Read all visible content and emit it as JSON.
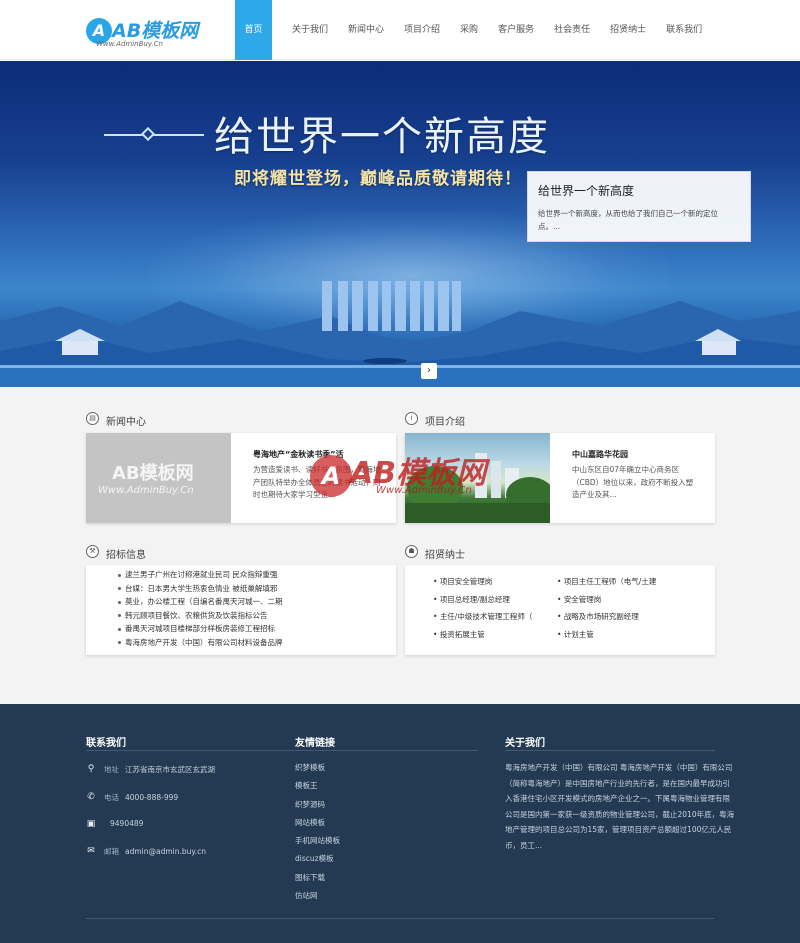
{
  "header": {
    "logo_mark": "A",
    "logo_name": "AB模板网",
    "logo_url": "Www.AdminBuy.Cn",
    "nav": [
      "首页",
      "关于我们",
      "新闻中心",
      "项目介绍",
      "采购",
      "客户服务",
      "社会责任",
      "招贤纳士",
      "联系我们"
    ],
    "active_index": 0
  },
  "banner": {
    "headline": "给世界一个新高度",
    "subline": "即将耀世登场，巅峰品质敬请期待！",
    "caption_title": "给世界一个新高度",
    "caption_desc": "给世界一个新高度，从而也给了我们自己一个新的定位点。...",
    "next_arrow": "›"
  },
  "news": {
    "title": "新闻中心",
    "icon": "document-icon",
    "image_watermark_main": "AB模板网",
    "image_watermark_url": "Www.AdminBuy.Cn",
    "item_title": "粤海地产“金秋读书季”活",
    "item_desc": "为营造爱读书、读好书的氛围，粤海地产团队特举办全体员工的读书活动，同时也期待大家学习型企..."
  },
  "projects": {
    "title": "项目介绍",
    "icon": "info-icon",
    "item_title": "中山嘉路华花园",
    "item_desc": "中山东区自07年确立中心商务区（CBD）地位以来，政府不断投入塑造产业及其..."
  },
  "tenders": {
    "title": "招标信息",
    "icon": "gavel-icon",
    "items": [
      "逮兰男子广州在讨称港就业民司 民众指辩重强",
      "台媒：日本男大学生热衷色情业 被纸巢解填邪",
      "莫业，办公楼工程（自编名番禺天河城一、二期",
      "韩元顾项目餐饮、农粮供货及饮装指标公告",
      "番禺天河城项目楼梯部分样板房装修工程招标",
      "粤海房地产开发（中国）有限公司材料设备品牌"
    ]
  },
  "jobs": {
    "title": "招贤纳士",
    "icon": "person-icon",
    "items": [
      [
        "项目安全管理岗",
        "项目主任工程师（电气/土建"
      ],
      [
        "项目总经理/副总经理",
        "安全管理岗"
      ],
      [
        "主任/中级技术管理工程师（",
        "战略及市场研究副经理"
      ],
      [
        "投资拓展主管",
        "计划主管"
      ]
    ]
  },
  "watermark": {
    "mark": "A",
    "name": "AB模板网",
    "url": "Www.AdminBuy.Cn"
  },
  "footer": {
    "contact": {
      "title": "联系我们",
      "rows": [
        {
          "icon": "location-icon",
          "label": "地址",
          "value": "江苏省南京市玄武区玄武湖"
        },
        {
          "icon": "phone-icon",
          "label": "电话",
          "value": "4000-888-999"
        },
        {
          "icon": "fax-icon",
          "label": "",
          "value": "9490489"
        },
        {
          "icon": "mail-icon",
          "label": "邮箱",
          "value": "admin@admin.buy.cn"
        }
      ]
    },
    "links": {
      "title": "友情链接",
      "items": [
        "织梦模板",
        "模板王",
        "织梦源码",
        "网站模板",
        "手机网站模板",
        "discuz模板",
        "图标下载",
        "仿站网"
      ]
    },
    "about": {
      "title": "关于我们",
      "text": "粤海房地产开发（中国）有限公司 粤海房地产开发（中国）有限公司（简称粤海地产）是中国房地产行业的先行者，是在国内最早成功引入香港住宅小区开发模式的房地产企业之一。下属粤海物业管理有限公司是国内第一家获一级资质的物业管理公司，截止2010年底，粤海地产管理的项目总公司为15家，管理项目资产总额超过100亿元人民币，员工..."
    }
  },
  "colors": {
    "accent": "#2ea8e8",
    "footer_bg": "#233a52",
    "content_bg": "#f3f3f3"
  }
}
